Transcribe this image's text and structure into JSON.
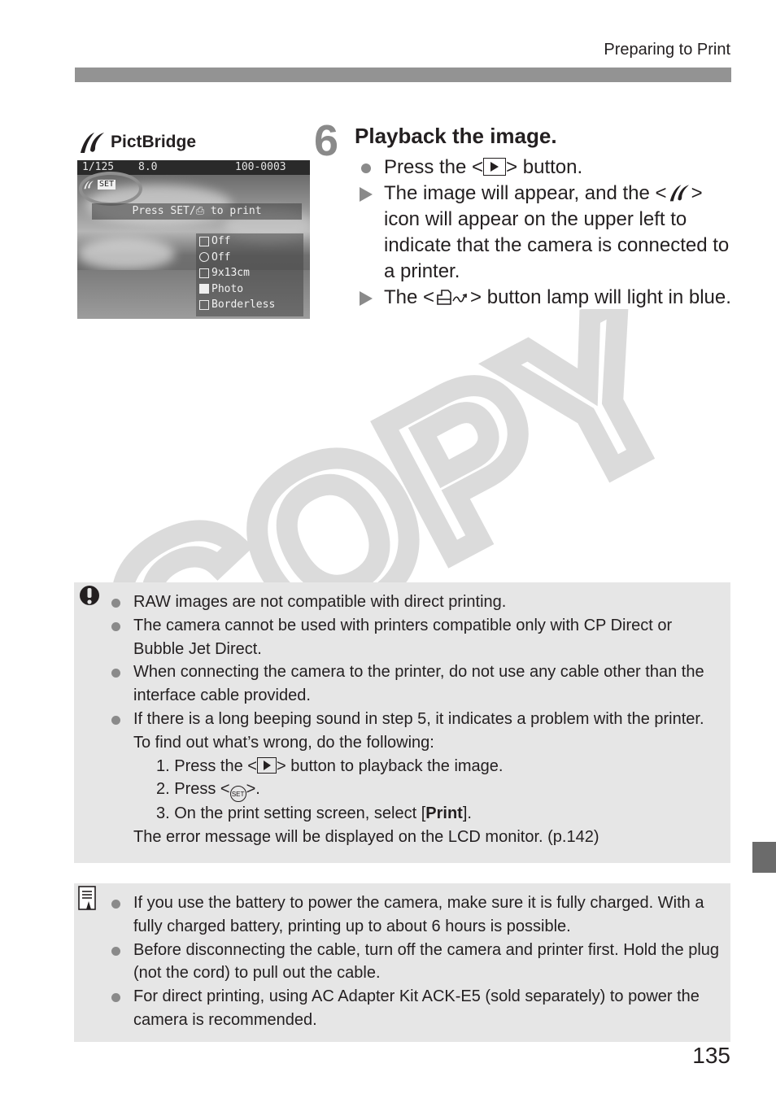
{
  "header": {
    "section_title": "Preparing to Print"
  },
  "sidebar_label": {
    "icon": "pictbridge-icon",
    "text": "PictBridge"
  },
  "lcd_screen": {
    "shutter": "1/125",
    "aperture": "8.0",
    "file_number": "100-0003",
    "set_badge": "SET",
    "prompt": "Press SET/⎙ to print",
    "settings": [
      {
        "icon": "image-effect-icon",
        "value": "Off"
      },
      {
        "icon": "date-icon",
        "value": "Off"
      },
      {
        "icon": "paper-size-icon",
        "value": "9x13cm"
      },
      {
        "icon": "paper-type-icon",
        "value": "Photo"
      },
      {
        "icon": "layout-icon",
        "value": "Borderless"
      }
    ]
  },
  "step": {
    "number": "6",
    "title": "Playback the image.",
    "items": [
      {
        "bullet": "dot",
        "before": "Press the <",
        "icon": "playback-button-icon",
        "after": "> button."
      },
      {
        "bullet": "arrow",
        "before": "The image will appear, and the <",
        "icon": "pictbridge-icon",
        "after": "> icon will appear on the upper left to indicate that the camera is connected to a printer."
      },
      {
        "bullet": "arrow",
        "before": "The <",
        "icon": "print-share-icon",
        "after": "> button lamp will light in blue."
      }
    ]
  },
  "watermark": "COPY",
  "caution": {
    "icon": "caution-icon",
    "items": [
      "RAW images are not compatible with direct printing.",
      "The camera cannot be used with printers compatible only with CP Direct or Bubble Jet Direct.",
      "When connecting the camera to the printer, do not use any cable other than the interface cable provided.",
      "If there is a long beeping sound in step 5, it indicates a problem with the printer. To find out what’s wrong, do the following:"
    ],
    "sub_steps": {
      "s1_before": "1. Press the <",
      "s1_after": "> button to playback the image.",
      "s2_before": "2. Press <",
      "s2_icon_text": "SET",
      "s2_after": ">.",
      "s3_before": "3. On the print setting screen, select [",
      "s3_bold": "Print",
      "s3_after": "]."
    },
    "closing": "The error message will be displayed on the LCD monitor. (p.142)"
  },
  "note": {
    "icon": "note-icon",
    "items": [
      "If you use the battery to power the camera, make sure it is fully charged. With a fully charged battery, printing up to about 6 hours is possible.",
      "Before disconnecting the cable, turn off the camera and printer first. Hold the plug (not the cord) to pull out the cable.",
      "For direct printing, using AC Adapter Kit ACK-E5 (sold separately) to power the camera is recommended."
    ]
  },
  "page_number": "135",
  "colors": {
    "header_bar": "#939393",
    "box_bg": "#e6e6e6",
    "bullet": "#8a8a8a",
    "tab_marker": "#6b6b6b"
  }
}
